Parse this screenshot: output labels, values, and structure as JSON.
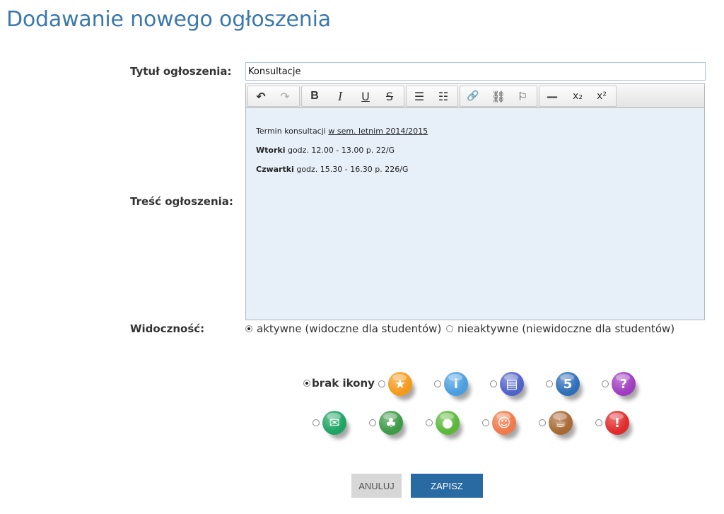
{
  "page": {
    "title": "Dodawanie nowego ogłoszenia"
  },
  "form": {
    "title_label": "Tytuł ogłoszenia:",
    "title_value": "Konsultacje",
    "content_label": "Treść ogłoszenia:",
    "visibility_label": "Widoczność:"
  },
  "editor": {
    "toolbar": {
      "undo": "↶",
      "redo": "↷",
      "bold": "B",
      "italic": "I",
      "underline": "U",
      "strike": "S",
      "bullets": "☰",
      "numbers": "☷",
      "link": "🔗",
      "unlink": "⛓",
      "bookmark": "⚐",
      "hr": "—",
      "sub": "x₂",
      "sup": "x²"
    },
    "line1": {
      "text": "Termin konsultacji ",
      "underlined": "w sem. letnim 2014/2015"
    },
    "line2": {
      "bold": "Wtorki",
      "text": " godz. 12.00 - 13.00 p. 22/G"
    },
    "line3": {
      "bold": "Czwartki",
      "text": " godz. 15.30 - 16.30 p. 226/G"
    }
  },
  "visibility": {
    "active": "aktywne (widoczne dla studentów)",
    "inactive": "nieaktywne (niewidoczne dla studentów)",
    "selected": "active"
  },
  "icons": {
    "no_icon_label": "brak ikony",
    "row1": [
      {
        "name": "star-icon",
        "color": "#f39a1c",
        "glyph": "★"
      },
      {
        "name": "info-icon",
        "color": "#4a9ee0",
        "glyph": "i"
      },
      {
        "name": "document-icon",
        "color": "#4f63c9",
        "glyph": "▤"
      },
      {
        "name": "five-icon",
        "color": "#2f6fb8",
        "glyph": "5"
      },
      {
        "name": "question-icon",
        "color": "#a03cc0",
        "glyph": "?"
      }
    ],
    "row2": [
      {
        "name": "mail-icon",
        "color": "#1fa463",
        "glyph": "✉"
      },
      {
        "name": "group-icon",
        "color": "#3d9b47",
        "glyph": "♣"
      },
      {
        "name": "person-icon",
        "color": "#5cb83a",
        "glyph": "●"
      },
      {
        "name": "smiley-icon",
        "color": "#f07a4a",
        "glyph": "☺"
      },
      {
        "name": "coffee-icon",
        "color": "#a86a35",
        "glyph": "☕"
      },
      {
        "name": "exclamation-icon",
        "color": "#e02b2b",
        "glyph": "!"
      }
    ]
  },
  "buttons": {
    "cancel": "ANULUJ",
    "save": "ZAPISZ"
  }
}
